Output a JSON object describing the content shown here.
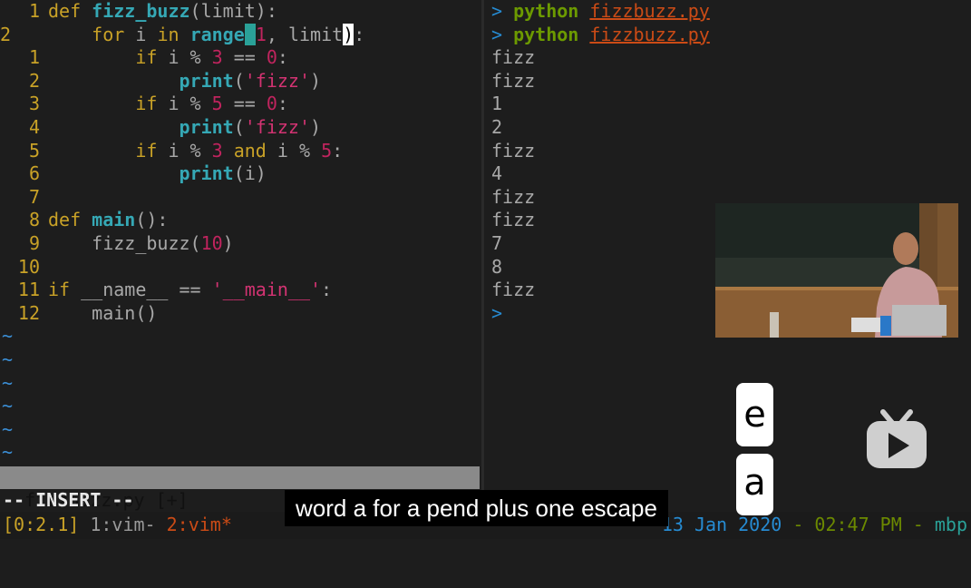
{
  "editor": {
    "lines": [
      {
        "ln": "1",
        "cur": false,
        "tokens": [
          [
            "kw",
            "def "
          ],
          [
            "fn",
            "fizz_buzz"
          ],
          [
            "op",
            "(limit):"
          ]
        ]
      },
      {
        "ln": "2",
        "cur": true,
        "tokens": [
          [
            "op",
            "    "
          ],
          [
            "kw",
            "for "
          ],
          [
            "op",
            "i "
          ],
          [
            "kw",
            "in "
          ],
          [
            "fn",
            "range"
          ],
          [
            "cursor-block",
            "("
          ],
          [
            "num",
            "1"
          ],
          [
            "op",
            ", limit"
          ],
          [
            "cursor-paren",
            ")"
          ],
          [
            "op",
            ":"
          ]
        ]
      },
      {
        "ln": "1",
        "cur": false,
        "tokens": [
          [
            "op",
            "        "
          ],
          [
            "kw",
            "if "
          ],
          [
            "op",
            "i % "
          ],
          [
            "num",
            "3"
          ],
          [
            "op",
            " == "
          ],
          [
            "num",
            "0"
          ],
          [
            "op",
            ":"
          ]
        ]
      },
      {
        "ln": "2",
        "cur": false,
        "tokens": [
          [
            "op",
            "            "
          ],
          [
            "fn",
            "print"
          ],
          [
            "op",
            "("
          ],
          [
            "str",
            "'fizz'"
          ],
          [
            "op",
            ")"
          ]
        ]
      },
      {
        "ln": "3",
        "cur": false,
        "tokens": [
          [
            "op",
            "        "
          ],
          [
            "kw",
            "if "
          ],
          [
            "op",
            "i % "
          ],
          [
            "num",
            "5"
          ],
          [
            "op",
            " == "
          ],
          [
            "num",
            "0"
          ],
          [
            "op",
            ":"
          ]
        ]
      },
      {
        "ln": "4",
        "cur": false,
        "tokens": [
          [
            "op",
            "            "
          ],
          [
            "fn",
            "print"
          ],
          [
            "op",
            "("
          ],
          [
            "str",
            "'fizz'"
          ],
          [
            "op",
            ")"
          ]
        ]
      },
      {
        "ln": "5",
        "cur": false,
        "tokens": [
          [
            "op",
            "        "
          ],
          [
            "kw",
            "if "
          ],
          [
            "op",
            "i % "
          ],
          [
            "num",
            "3"
          ],
          [
            "op",
            " "
          ],
          [
            "kw",
            "and "
          ],
          [
            "op",
            "i % "
          ],
          [
            "num",
            "5"
          ],
          [
            "op",
            ":"
          ]
        ]
      },
      {
        "ln": "6",
        "cur": false,
        "tokens": [
          [
            "op",
            "            "
          ],
          [
            "fn",
            "print"
          ],
          [
            "op",
            "(i)"
          ]
        ]
      },
      {
        "ln": "7",
        "cur": false,
        "tokens": []
      },
      {
        "ln": "8",
        "cur": false,
        "tokens": [
          [
            "kw",
            "def "
          ],
          [
            "fn",
            "main"
          ],
          [
            "op",
            "():"
          ]
        ]
      },
      {
        "ln": "9",
        "cur": false,
        "tokens": [
          [
            "op",
            "    fizz_buzz("
          ],
          [
            "num",
            "10"
          ],
          [
            "op",
            ")"
          ]
        ]
      },
      {
        "ln": "10",
        "cur": false,
        "tokens": []
      },
      {
        "ln": "11",
        "cur": false,
        "tokens": [
          [
            "kw",
            "if "
          ],
          [
            "op",
            "__name__ == "
          ],
          [
            "str",
            "'__main__'"
          ],
          [
            "op",
            ":"
          ]
        ]
      },
      {
        "ln": "12",
        "cur": false,
        "tokens": [
          [
            "op",
            "    main()"
          ]
        ]
      }
    ],
    "tildes": [
      "~",
      "~",
      "~",
      "~",
      "~",
      "~"
    ]
  },
  "statusline": {
    "filename": "fizzbuzz.py [+]"
  },
  "mode": "-- INSERT --",
  "terminal": {
    "commands": [
      {
        "prompt": ">",
        "cmd": "python",
        "arg": "fizzbuzz.py"
      },
      {
        "prompt": ">",
        "cmd": "python",
        "arg": "fizzbuzz.py"
      }
    ],
    "output": [
      "fizz",
      "fizz",
      "1",
      "2",
      "fizz",
      "4",
      "fizz",
      "fizz",
      "7",
      "8",
      "fizz"
    ],
    "final_prompt": ">"
  },
  "tmux": {
    "session": "[0:2.1]",
    "window1": " 1:vim- ",
    "window2": "2:vim*",
    "date": "13 Jan 2020",
    "sep1": " - ",
    "time": "02:47 PM",
    "sep2": " - ",
    "host": "mbp"
  },
  "caption": "word a for a pend plus one escape",
  "keys": {
    "key1": "e",
    "key2": "a"
  },
  "colors": {
    "background": "#1d1d1d",
    "keyword": "#c9a227",
    "function": "#35a8b5",
    "number": "#c0245e",
    "prompt": "#268bd2",
    "command": "#6c9a00",
    "argument": "#cb4b16"
  },
  "icons": {
    "tv_logo": "tv-play-icon"
  }
}
